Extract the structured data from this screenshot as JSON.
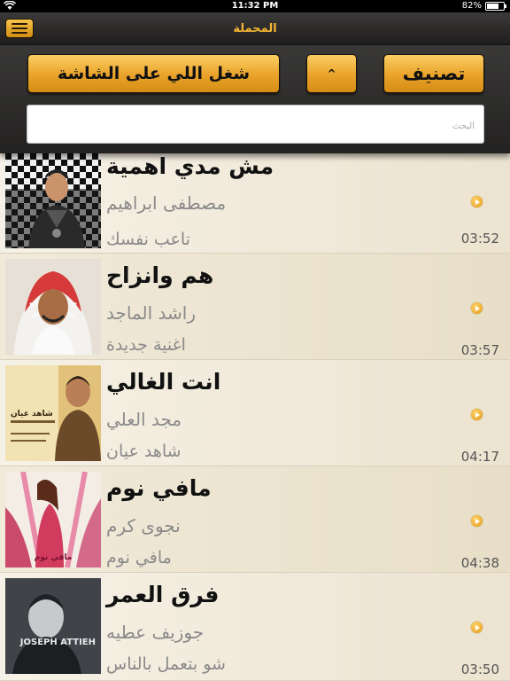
{
  "status_bar": {
    "time": "11:32 PM",
    "battery": "82%",
    "battery_level": 0.82
  },
  "nav": {
    "title": "المحملة",
    "menu_icon": "hamburger-menu-icon"
  },
  "controls": {
    "play_on_screen_label": "شغل اللي على الشاشة",
    "sort_direction_label": "^",
    "sort_label": "تصنيف",
    "search_placeholder": "البحث"
  },
  "colors": {
    "accent": "#f3b433",
    "button_top": "#fbcf63",
    "button_bottom": "#d58d14"
  },
  "songs": [
    {
      "title": "مش مدي اهمية",
      "artist": "مصطفى ابراهيم",
      "album": "تاعب نفسك",
      "duration": "03:52"
    },
    {
      "title": "هم وانزاح",
      "artist": "راشد الماجد",
      "album": "اغنية جديدة",
      "duration": "03:57"
    },
    {
      "title": "انت الغالي",
      "artist": "مجد العلي",
      "album": "شاهد عيان",
      "duration": "04:17",
      "art_text": "شاهد عيان"
    },
    {
      "title": "مافي نوم",
      "artist": "نجوى كرم",
      "album": "مافي نوم",
      "duration": "04:38",
      "art_text": "مافي نوم"
    },
    {
      "title": "فرق العمر",
      "artist": "جوزيف عطيه",
      "album": "شو بتعمل بالناس",
      "duration": "03:50",
      "art_text": "JOSEPH ATTIEH"
    }
  ]
}
